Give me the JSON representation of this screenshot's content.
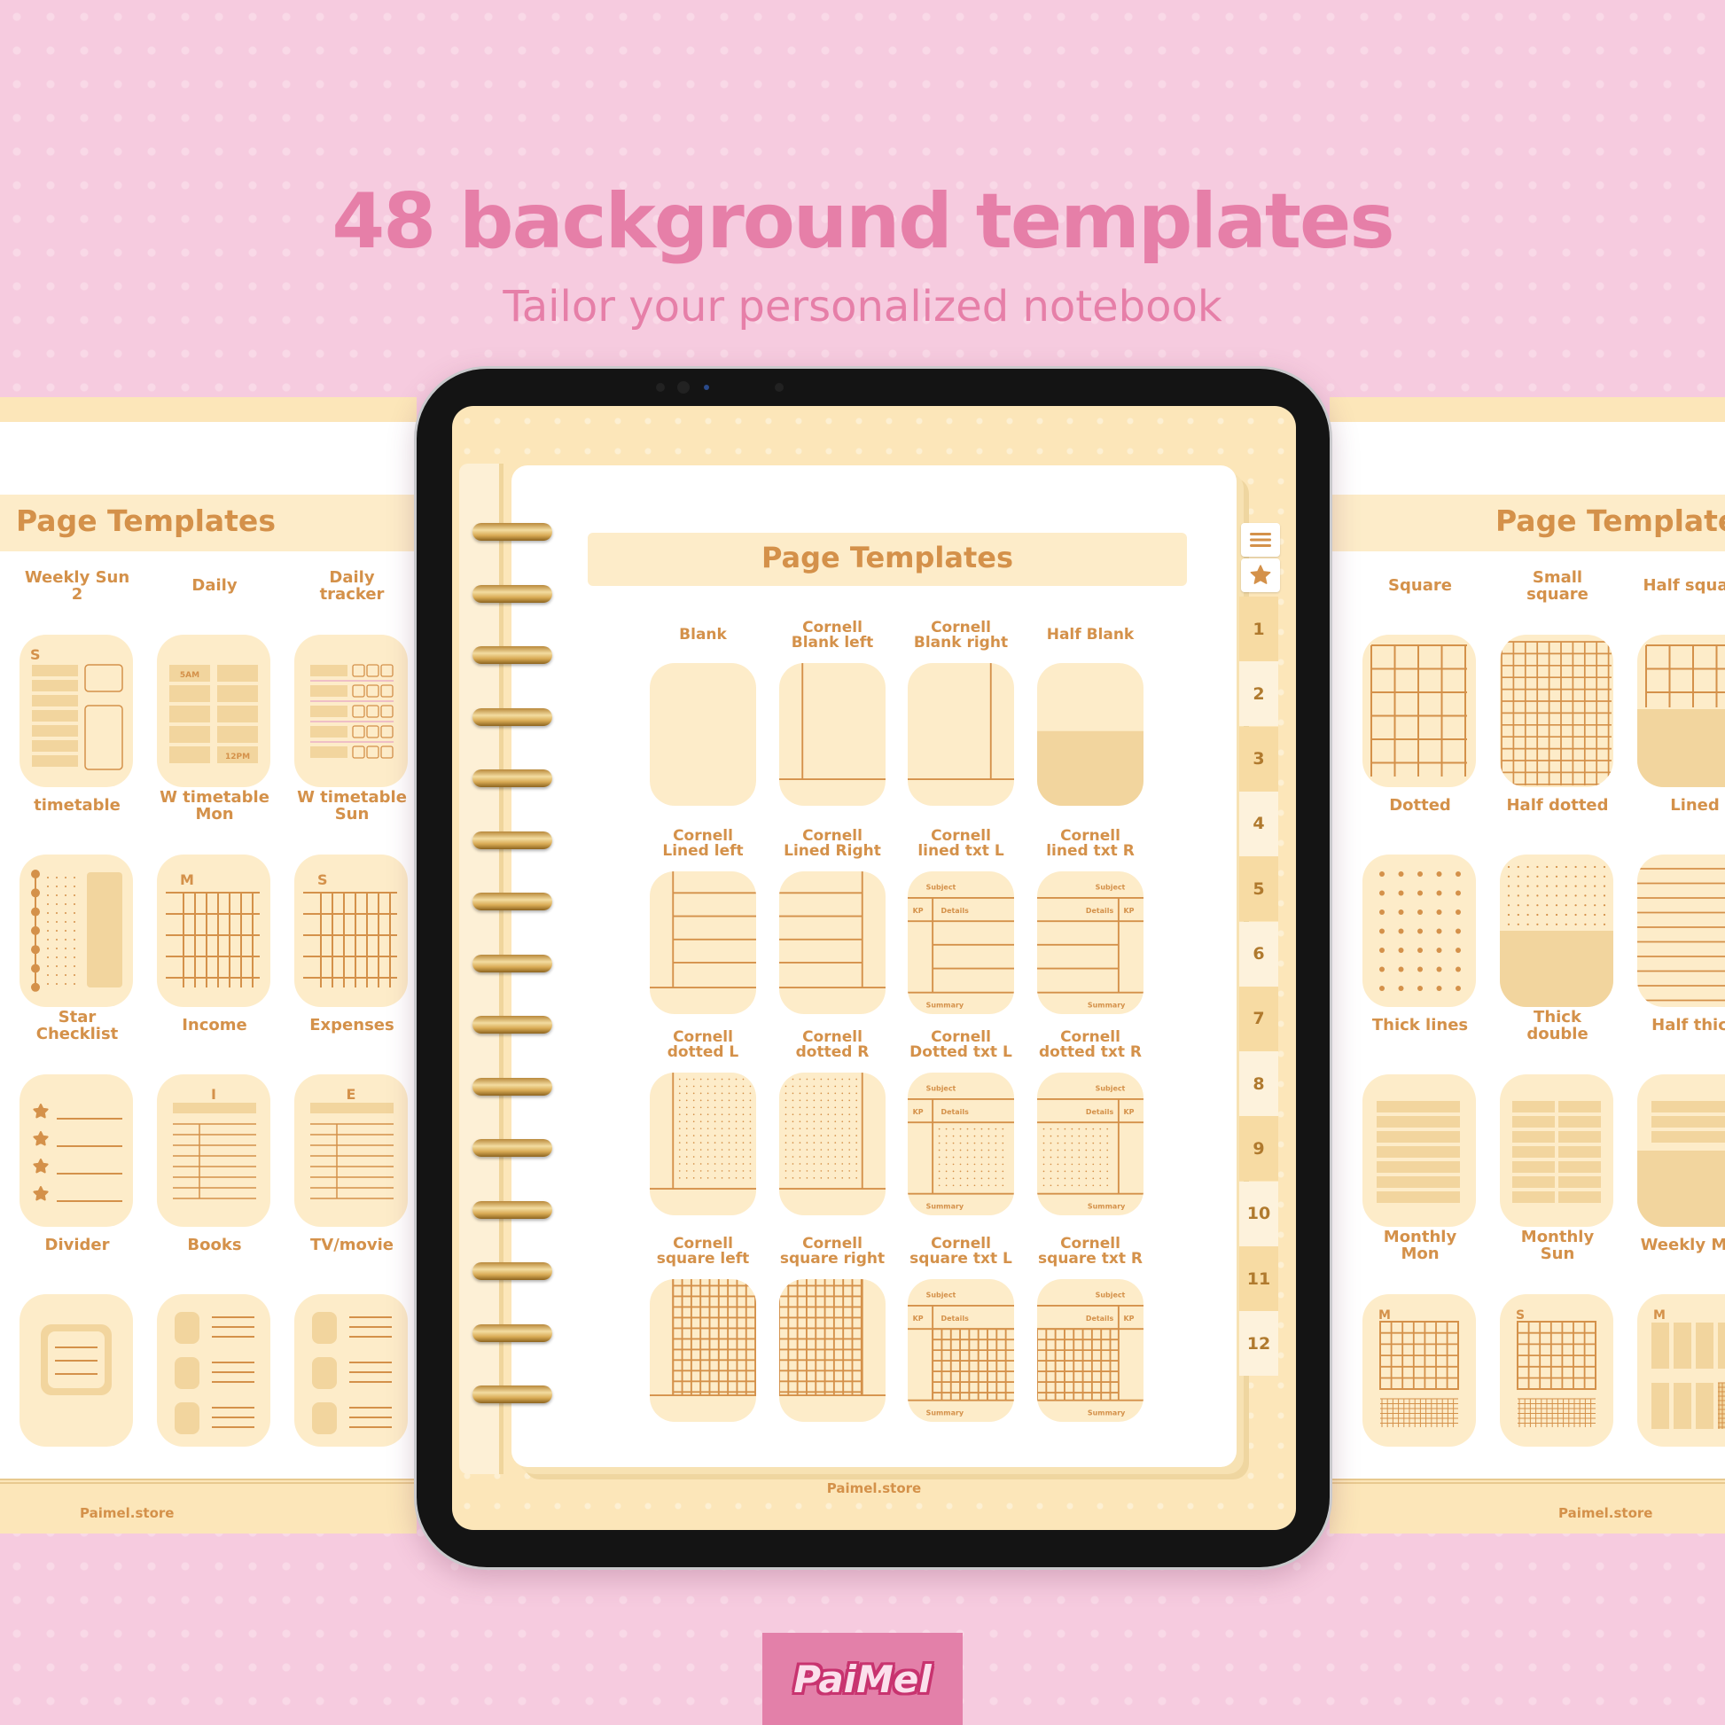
{
  "header": {
    "title": "48 background templates",
    "subtitle": "Tailor your personalized notebook"
  },
  "colors": {
    "background_pink": "#f6cbdf",
    "title_pink": "#e67fa8",
    "accent_brown": "#d4914a",
    "thumb_cream": "#fdecc9",
    "thumb_dark": "#f2d59e",
    "band_yellow": "#fce6b9",
    "logo_pink": "#e380a9"
  },
  "left_page": {
    "title": "Page Templates",
    "footer": "Paimel.store",
    "templates": [
      {
        "label": "Weekly Sun\n2",
        "type": "weekly",
        "letter": "S"
      },
      {
        "label": "Daily",
        "type": "daily",
        "top": "5AM",
        "bottom": "12PM"
      },
      {
        "label": "Daily\ntracker",
        "type": "tracker"
      },
      {
        "label": "timetable",
        "type": "timetable"
      },
      {
        "label": "W timetable\nMon",
        "type": "wtime",
        "letter": "M"
      },
      {
        "label": "W timetable\nSun",
        "type": "wtime",
        "letter": "S"
      },
      {
        "label": "Star\nChecklist",
        "type": "star"
      },
      {
        "label": "Income",
        "type": "ledger",
        "letter": "I"
      },
      {
        "label": "Expenses",
        "type": "ledger",
        "letter": "E"
      },
      {
        "label": "Divider",
        "type": "divider"
      },
      {
        "label": "Books",
        "type": "list3"
      },
      {
        "label": "TV/movie",
        "type": "list3"
      }
    ]
  },
  "center_page": {
    "title": "Page Templates",
    "footer": "Paimel.store",
    "menu_icon": "hamburger-menu-icon",
    "star_icon": "star-icon",
    "tabs": [
      "1",
      "2",
      "3",
      "4",
      "5",
      "6",
      "7",
      "8",
      "9",
      "10",
      "11",
      "12"
    ],
    "templates": [
      {
        "label": "Blank",
        "type": "blank"
      },
      {
        "label": "Cornell\nBlank left",
        "type": "cornell",
        "side": "L",
        "fill": "none"
      },
      {
        "label": "Cornell\nBlank right",
        "type": "cornell",
        "side": "R",
        "fill": "none"
      },
      {
        "label": "Half Blank",
        "type": "half"
      },
      {
        "label": "Cornell\nLined left",
        "type": "cornell",
        "side": "L",
        "fill": "lines"
      },
      {
        "label": "Cornell\nLined Right",
        "type": "cornell",
        "side": "R",
        "fill": "lines"
      },
      {
        "label": "Cornell\nlined txt L",
        "type": "cornelltxt",
        "side": "L",
        "fill": "lines"
      },
      {
        "label": "Cornell\nlined txt R",
        "type": "cornelltxt",
        "side": "R",
        "fill": "lines"
      },
      {
        "label": "Cornell\ndotted L",
        "type": "cornell",
        "side": "L",
        "fill": "dots"
      },
      {
        "label": "Cornell\ndotted R",
        "type": "cornell",
        "side": "R",
        "fill": "dots"
      },
      {
        "label": "Cornell\nDotted txt L",
        "type": "cornelltxt",
        "side": "L",
        "fill": "dots"
      },
      {
        "label": "Cornell\ndotted txt R",
        "type": "cornelltxt",
        "side": "R",
        "fill": "dots"
      },
      {
        "label": "Cornell\nsquare left",
        "type": "cornell",
        "side": "L",
        "fill": "grid"
      },
      {
        "label": "Cornell\nsquare right",
        "type": "cornell",
        "side": "R",
        "fill": "grid"
      },
      {
        "label": "Cornell\nsquare txt L",
        "type": "cornelltxt",
        "side": "L",
        "fill": "grid"
      },
      {
        "label": "Cornell\nsquare txt R",
        "type": "cornelltxt",
        "side": "R",
        "fill": "grid"
      }
    ],
    "cornell_text": {
      "subject": "Subject",
      "kp": "KP",
      "details": "Details",
      "summary": "Summary"
    }
  },
  "right_page": {
    "title": "Page Templates",
    "footer": "Paimel.store",
    "templates": [
      {
        "label": "Square",
        "type": "square"
      },
      {
        "label": "Small\nsquare",
        "type": "smallsquare"
      },
      {
        "label": "Half square",
        "type": "halfsquare"
      },
      {
        "label": "Dotted",
        "type": "dotted"
      },
      {
        "label": "Half dotted",
        "type": "halfdotted"
      },
      {
        "label": "Lined",
        "type": "lined"
      },
      {
        "label": "Thick lines",
        "type": "thick"
      },
      {
        "label": "Thick\ndouble",
        "type": "thickdouble"
      },
      {
        "label": "Half thick",
        "type": "halfthick"
      },
      {
        "label": "Monthly\nMon",
        "type": "monthly",
        "letter": "M"
      },
      {
        "label": "Monthly\nSun",
        "type": "monthly",
        "letter": "S"
      },
      {
        "label": "Weekly Mon",
        "type": "weeklycols",
        "letter": "M"
      }
    ]
  },
  "brand": {
    "logo_text": "PaiMel"
  }
}
